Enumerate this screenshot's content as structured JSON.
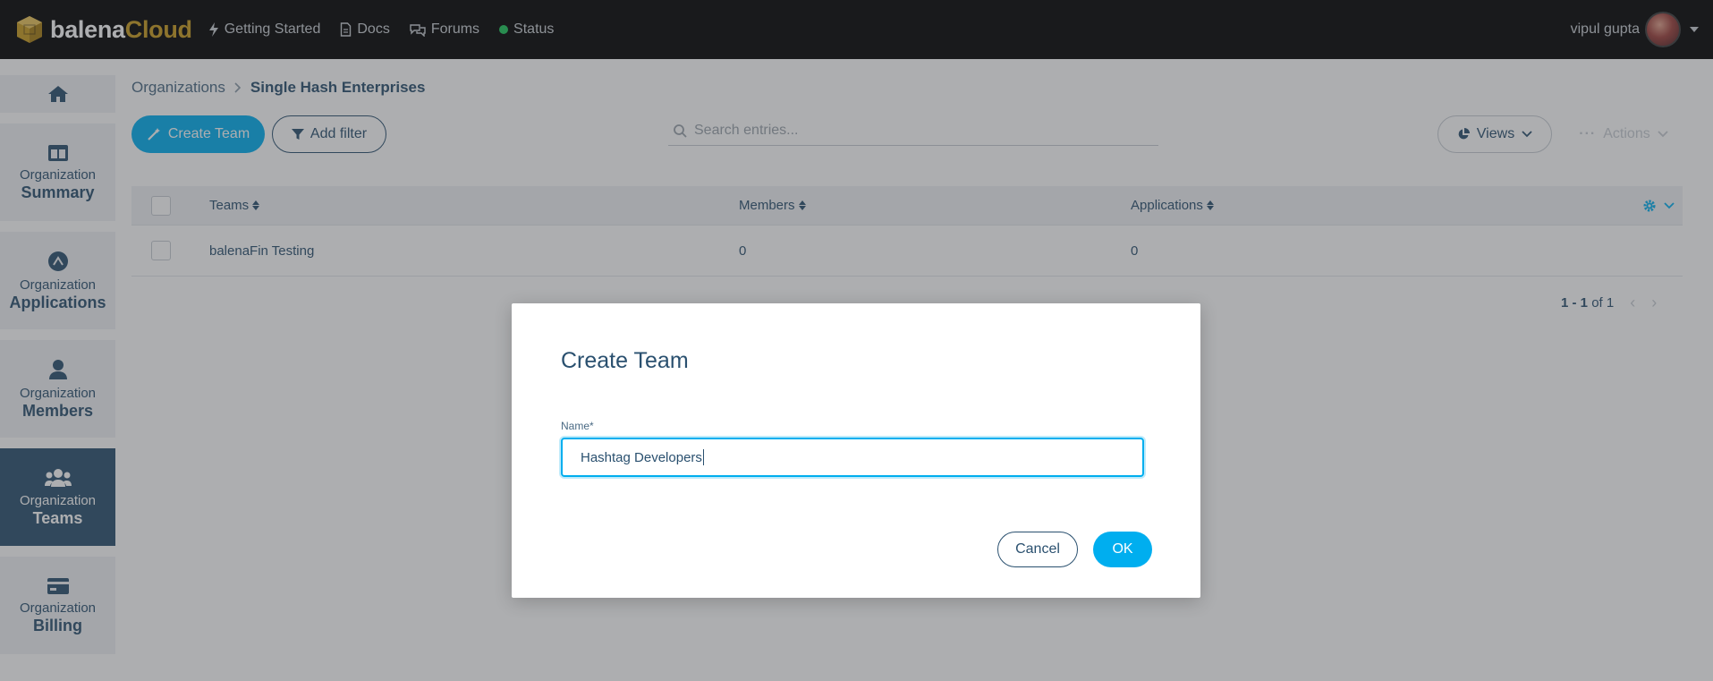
{
  "colors": {
    "accent": "#00aeef",
    "primary_text": "#2a506f",
    "brand_gold": "#c99b1e",
    "status_online": "#1cc65a",
    "topbar_bg": "#000000"
  },
  "topbar": {
    "logo_main": "balena",
    "logo_accent": "Cloud",
    "nav": [
      {
        "label": "Getting Started",
        "icon": "bolt-icon"
      },
      {
        "label": "Docs",
        "icon": "document-icon"
      },
      {
        "label": "Forums",
        "icon": "chat-icon"
      },
      {
        "label": "Status",
        "icon": "status-dot-icon"
      }
    ],
    "user_name": "vipul gupta"
  },
  "sidebar": {
    "items": [
      {
        "icon": "home-icon"
      },
      {
        "prefix": "Organization",
        "label": "Summary",
        "icon": "summary-icon"
      },
      {
        "prefix": "Organization",
        "label": "Applications",
        "icon": "applications-icon"
      },
      {
        "prefix": "Organization",
        "label": "Members",
        "icon": "member-icon"
      },
      {
        "prefix": "Organization",
        "label": "Teams",
        "icon": "teams-icon",
        "active": true
      },
      {
        "prefix": "Organization",
        "label": "Billing",
        "icon": "credit-card-icon"
      }
    ]
  },
  "breadcrumb": {
    "root": "Organizations",
    "current": "Single Hash Enterprises"
  },
  "toolbar": {
    "create_label": "Create Team",
    "filter_label": "Add filter",
    "search_placeholder": "Search entries...",
    "views_label": "Views",
    "actions_label": "Actions"
  },
  "table": {
    "columns": [
      "Teams",
      "Members",
      "Applications"
    ],
    "rows": [
      {
        "team": "balenaFin Testing",
        "members": "0",
        "applications": "0"
      }
    ],
    "pagination": {
      "range": "1 - 1",
      "of_label": "of",
      "total": "1"
    }
  },
  "modal": {
    "title": "Create Team",
    "field_label": "Name*",
    "field_value": "Hashtag Developers",
    "cancel_label": "Cancel",
    "ok_label": "OK"
  }
}
